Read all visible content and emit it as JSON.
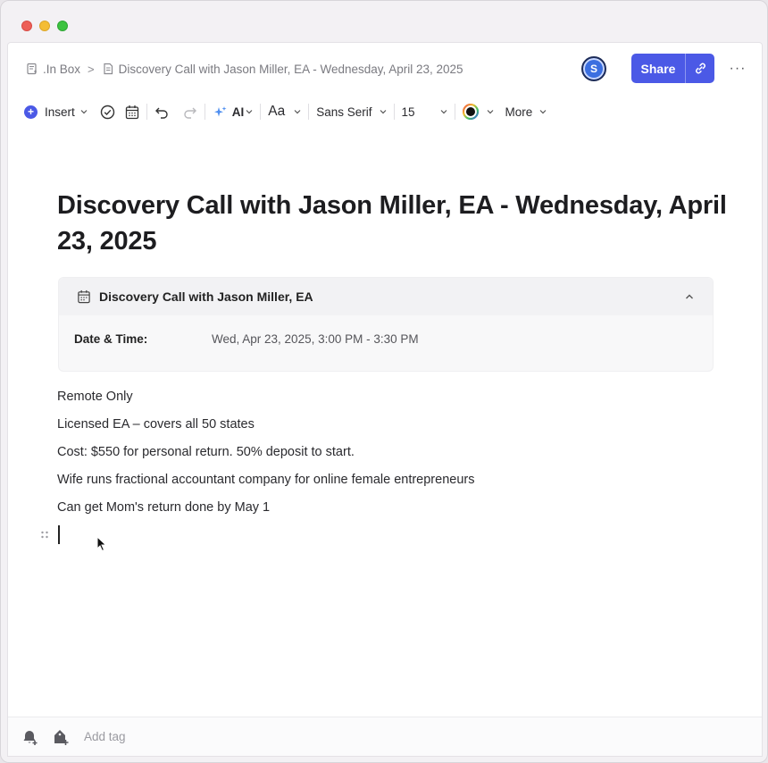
{
  "breadcrumb": {
    "root": ".In Box",
    "separator": ">",
    "current": "Discovery Call with Jason Miller, EA - Wednesday, April 23, 2025"
  },
  "header": {
    "avatar_initial": "S",
    "share_label": "Share",
    "more_dots": "···"
  },
  "toolbar": {
    "insert_label": "Insert",
    "ai_label": "AI",
    "text_style_label": "Aa",
    "font_family": "Sans Serif",
    "font_size": "15",
    "more_label": "More"
  },
  "document": {
    "title": "Discovery Call with Jason Miller, EA - Wednesday, April 23, 2025",
    "event": {
      "name": "Discovery Call with Jason Miller, EA",
      "date_label": "Date & Time:",
      "date_value": "Wed, Apr 23, 2025, 3:00 PM - 3:30 PM"
    },
    "notes": [
      "Remote Only",
      "Licensed EA – covers all 50 states",
      "Cost: $550 for personal return. 50% deposit to start.",
      "Wife runs fractional accountant company for online female entrepreneurs",
      "Can get Mom's return done by May 1"
    ]
  },
  "footer": {
    "add_tag_placeholder": "Add tag"
  },
  "colors": {
    "accent": "#4b59e6",
    "traffic_red": "#ed5f57",
    "traffic_yellow": "#f4bd35",
    "traffic_green": "#3cc33f"
  },
  "icons": [
    "note-icon",
    "document-icon",
    "link-icon",
    "check-circle-icon",
    "calendar-icon",
    "undo-icon",
    "redo-icon",
    "sparkle-icon",
    "color-picker-icon",
    "chevron-up-icon",
    "drag-handle-icon",
    "bell-plus-icon",
    "tag-plus-icon"
  ]
}
